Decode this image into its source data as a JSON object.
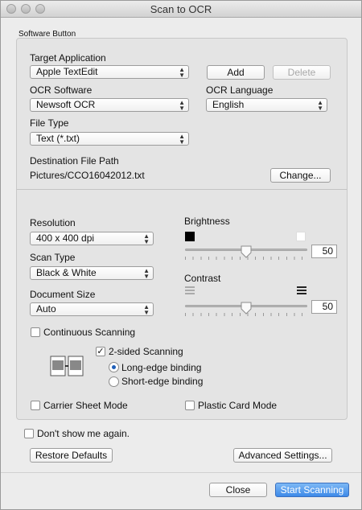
{
  "window": {
    "title": "Scan to OCR"
  },
  "group_title": "Software Button",
  "target_app": {
    "label": "Target Application",
    "value": "Apple TextEdit",
    "add": "Add",
    "delete": "Delete"
  },
  "ocr": {
    "software_label": "OCR Software",
    "software_value": "Newsoft OCR",
    "language_label": "OCR Language",
    "language_value": "English"
  },
  "file_type": {
    "label": "File Type",
    "value": "Text (*.txt)"
  },
  "destination": {
    "label": "Destination File Path",
    "path": "Pictures/CCO16042012.txt",
    "change": "Change..."
  },
  "resolution": {
    "label": "Resolution",
    "value": "400 x 400 dpi"
  },
  "scan_type": {
    "label": "Scan Type",
    "value": "Black & White"
  },
  "doc_size": {
    "label": "Document Size",
    "value": "Auto"
  },
  "brightness": {
    "label": "Brightness",
    "value": "50",
    "level": 0.5
  },
  "contrast": {
    "label": "Contrast",
    "value": "50",
    "level": 0.5
  },
  "continuous": {
    "label": "Continuous Scanning",
    "checked": false
  },
  "two_sided": {
    "label": "2-sided Scanning",
    "checked": true,
    "long_edge": "Long-edge binding",
    "short_edge": "Short-edge binding",
    "selected": "long"
  },
  "carrier": {
    "label": "Carrier Sheet Mode",
    "checked": false
  },
  "plastic": {
    "label": "Plastic Card Mode",
    "checked": false
  },
  "dont_show": {
    "label": "Don't show me again.",
    "checked": false
  },
  "buttons": {
    "restore": "Restore Defaults",
    "advanced": "Advanced Settings...",
    "close": "Close",
    "start": "Start Scanning"
  },
  "colors": {
    "accent": "#3d8ae8"
  }
}
